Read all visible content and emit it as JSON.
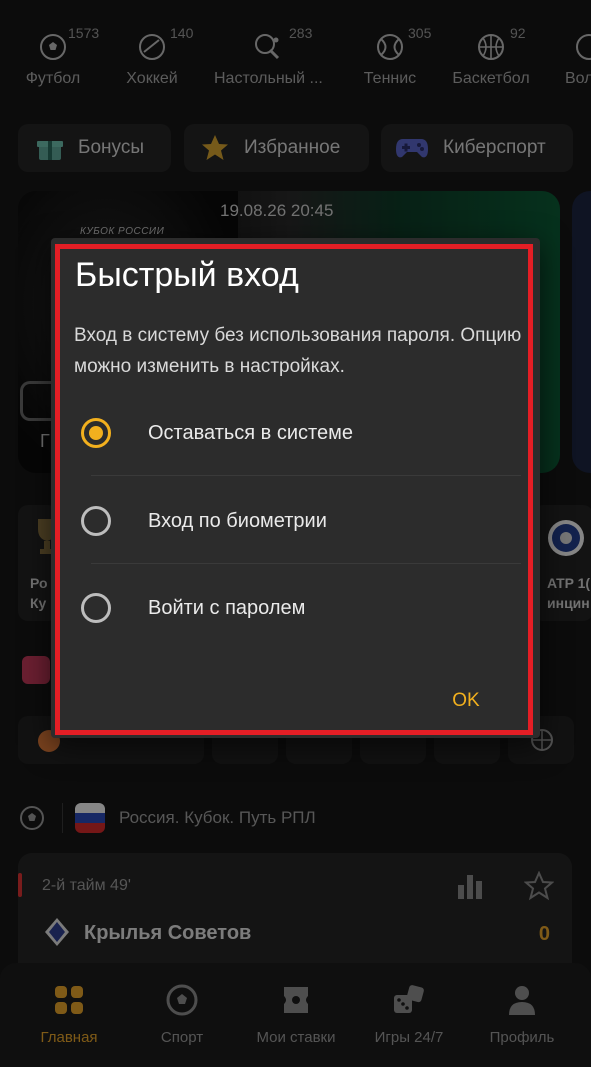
{
  "sports": [
    {
      "label": "Футбол",
      "count": "1573",
      "icon": "soccer-ball-icon"
    },
    {
      "label": "Хоккей",
      "count": "140",
      "icon": "hockey-icon"
    },
    {
      "label": "Настольный ...",
      "count": "283",
      "icon": "table-tennis-icon"
    },
    {
      "label": "Теннис",
      "count": "305",
      "icon": "tennis-ball-icon"
    },
    {
      "label": "Баскетбол",
      "count": "92",
      "icon": "basketball-icon"
    },
    {
      "label": "Вол",
      "count": "",
      "icon": "volleyball-icon"
    }
  ],
  "chips": [
    {
      "label": "Бонусы",
      "icon": "gift-icon"
    },
    {
      "label": "Избранное",
      "icon": "star-icon"
    },
    {
      "label": "Киберспорт",
      "icon": "gamepad-icon"
    }
  ],
  "banner": {
    "date": "19.08.26 20:45",
    "cup": "КУБОК РОССИИ",
    "partial_left": "Г"
  },
  "mini_cards": [
    {
      "text_line1": "Ро",
      "text_line2": "Ку"
    },
    {
      "text_line1": "ATP 1(",
      "text_line2": "инцин"
    }
  ],
  "league": {
    "title": "Россия. Кубок. Путь РПЛ"
  },
  "match": {
    "time": "2-й тайм 49'",
    "team": "Крылья Советов",
    "score": "0"
  },
  "bottom_nav": [
    {
      "label": "Главная",
      "icon": "home-grid-icon",
      "active": true
    },
    {
      "label": "Спорт",
      "icon": "soccer-ball-icon",
      "active": false
    },
    {
      "label": "Мои ставки",
      "icon": "ticket-icon",
      "active": false
    },
    {
      "label": "Игры 24/7",
      "icon": "dice-icon",
      "active": false
    },
    {
      "label": "Профиль",
      "icon": "user-icon",
      "active": false
    }
  ],
  "dialog": {
    "title": "Быстрый вход",
    "description": "Вход в систему без использования пароля. Опцию можно изменить в настройках.",
    "options": [
      {
        "label": "Оставаться в системе",
        "selected": true
      },
      {
        "label": "Вход по биометрии",
        "selected": false
      },
      {
        "label": "Войти с паролем",
        "selected": false
      }
    ],
    "ok_label": "OK"
  },
  "colors": {
    "accent": "#f2b01e",
    "highlight_frame": "#e41e25",
    "dialog_bg": "#2c2c2c",
    "page_bg": "#161616"
  }
}
